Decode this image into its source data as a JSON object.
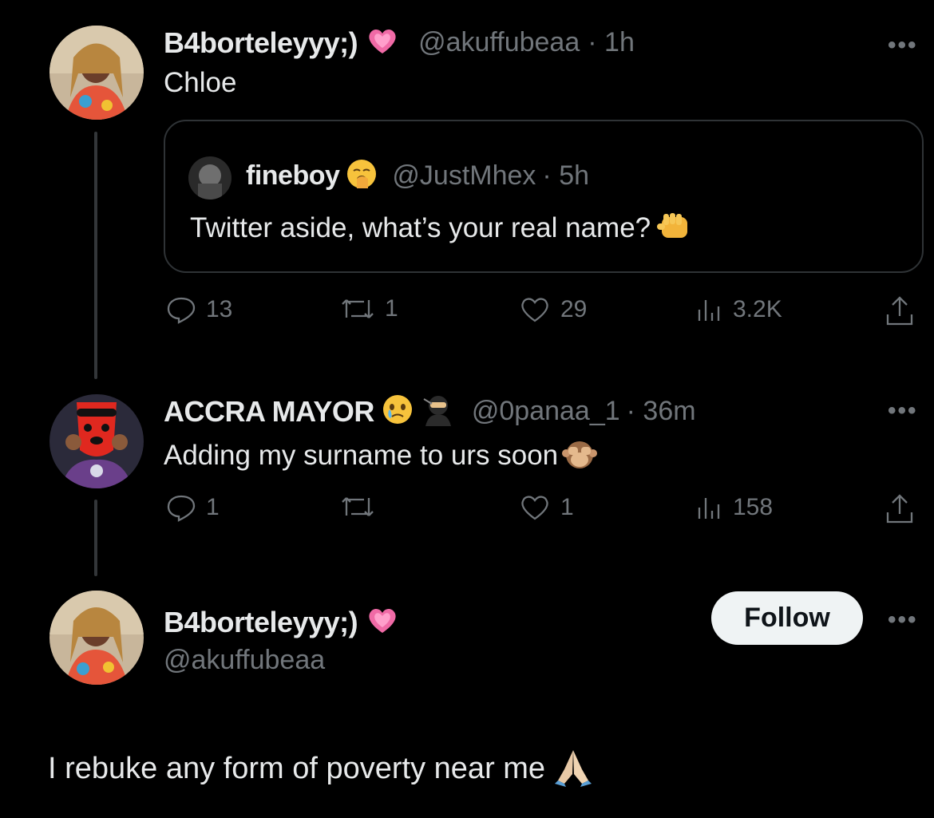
{
  "tweet1": {
    "display_name": "B4borteleyyy;)",
    "handle": "@akuffubeaa",
    "time": "· 1h",
    "text": "Chloe",
    "quoted": {
      "display_name": "fineboy",
      "handle": "@JustMhex",
      "time": "· 5h",
      "text": "Twitter aside, what’s your real name?"
    },
    "actions": {
      "replies": "13",
      "retweets": "1",
      "likes": "29",
      "views": "3.2K"
    }
  },
  "tweet2": {
    "display_name": "ACCRA MAYOR",
    "handle": "@0panaa_1",
    "time": "· 36m",
    "text": "Adding my surname to urs soon",
    "actions": {
      "replies": "1",
      "retweets": "",
      "likes": "1",
      "views": "158"
    }
  },
  "tweet3": {
    "display_name": "B4borteleyyy;)",
    "handle": "@akuffubeaa",
    "follow_label": "Follow",
    "text": "I rebuke any form of poverty near me"
  },
  "more_label": "•••",
  "icons": {
    "heart_emoji": "sparkling-heart-icon",
    "verified_accent": "#f06aa6"
  }
}
